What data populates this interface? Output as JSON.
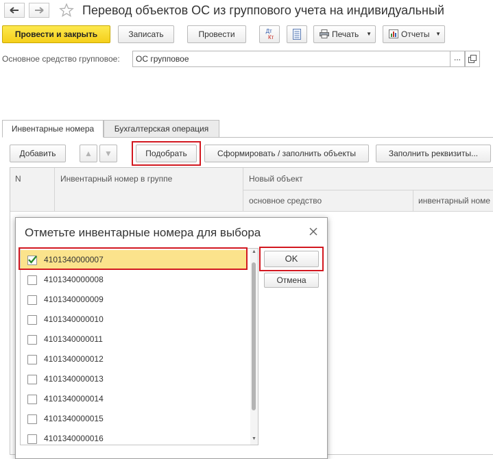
{
  "window": {
    "title": "Перевод объектов ОС из группового учета на индивидуальный"
  },
  "toolbar": {
    "post_close": "Провести и закрыть",
    "save": "Записать",
    "post": "Провести",
    "dt_kt_top": "Дт",
    "dt_kt_bottom": "Кт",
    "print": "Печать",
    "reports": "Отчеты"
  },
  "form": {
    "group_asset_label": "Основное средство групповое:",
    "group_asset_value": "ОС групповое",
    "select_glyph": "..."
  },
  "tabs": [
    {
      "label": "Инвентарные номера"
    },
    {
      "label": "Бухгалтерская операция"
    }
  ],
  "table_toolbar": {
    "add": "Добавить",
    "pick": "Подобрать",
    "generate": "Сформировать / заполнить объекты",
    "fill_props": "Заполнить реквизиты..."
  },
  "table": {
    "col_n": "N",
    "col_inv_group": "Инвентарный номер в группе",
    "col_new_object": "Новый объект",
    "sub_asset": "основное средство",
    "sub_inv": "инвентарный номе"
  },
  "dialog": {
    "title": "Отметьте инвентарные номера для выбора",
    "ok": "OK",
    "cancel": "Отмена",
    "items": [
      {
        "number": "4101340000007",
        "checked": true
      },
      {
        "number": "4101340000008",
        "checked": false
      },
      {
        "number": "4101340000009",
        "checked": false
      },
      {
        "number": "4101340000010",
        "checked": false
      },
      {
        "number": "4101340000011",
        "checked": false
      },
      {
        "number": "4101340000012",
        "checked": false
      },
      {
        "number": "4101340000013",
        "checked": false
      },
      {
        "number": "4101340000014",
        "checked": false
      },
      {
        "number": "4101340000015",
        "checked": false
      },
      {
        "number": "4101340000016",
        "checked": false
      }
    ]
  },
  "colors": {
    "primary_button": "#f5cf1b",
    "highlight": "#d2171f",
    "selected_row": "#fbe38c",
    "checkmark": "#2c8a2c"
  }
}
